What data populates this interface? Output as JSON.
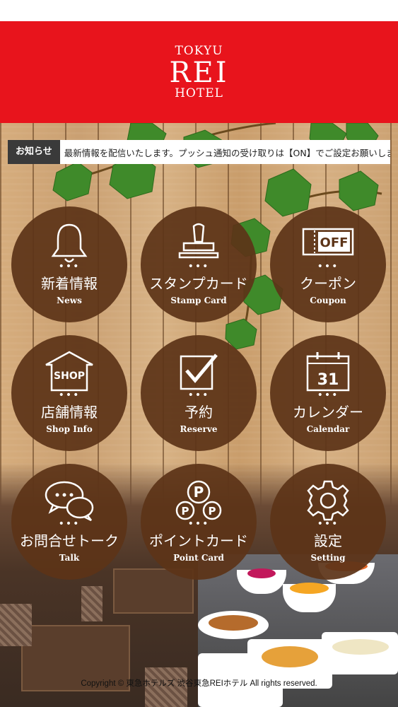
{
  "header": {
    "logo_line1": "TOKYU",
    "logo_line2": "REI",
    "logo_line3": "HOTEL",
    "background_color": "#e8141c"
  },
  "notice": {
    "label": "お知らせ",
    "text": "最新情報を配信いたします。プッシュ通知の受け取りは【ON】でご設定お願いします。"
  },
  "menu": [
    {
      "jp": "新着情報",
      "en": "News",
      "icon": "bell-icon"
    },
    {
      "jp": "スタンプカード",
      "en": "Stamp Card",
      "icon": "stamp-icon"
    },
    {
      "jp": "クーポン",
      "en": "Coupon",
      "icon": "coupon-off-icon",
      "icon_text": "OFF"
    },
    {
      "jp": "店舗情報",
      "en": "Shop Info",
      "icon": "shop-icon",
      "icon_text": "SHOP"
    },
    {
      "jp": "予約",
      "en": "Reserve",
      "icon": "checkbox-icon"
    },
    {
      "jp": "カレンダー",
      "en": "Calendar",
      "icon": "calendar-icon",
      "icon_text": "31"
    },
    {
      "jp": "お問合せトーク",
      "en": "Talk",
      "icon": "chat-bubbles-icon"
    },
    {
      "jp": "ポイントカード",
      "en": "Point Card",
      "icon": "points-icon",
      "icon_text": "P"
    },
    {
      "jp": "設定",
      "en": "Setting",
      "icon": "gear-icon"
    }
  ],
  "dots": "•••",
  "footer": {
    "copyright": "Copyright © 東急ホテルズ 渋谷東急REIホテル All rights reserved."
  }
}
